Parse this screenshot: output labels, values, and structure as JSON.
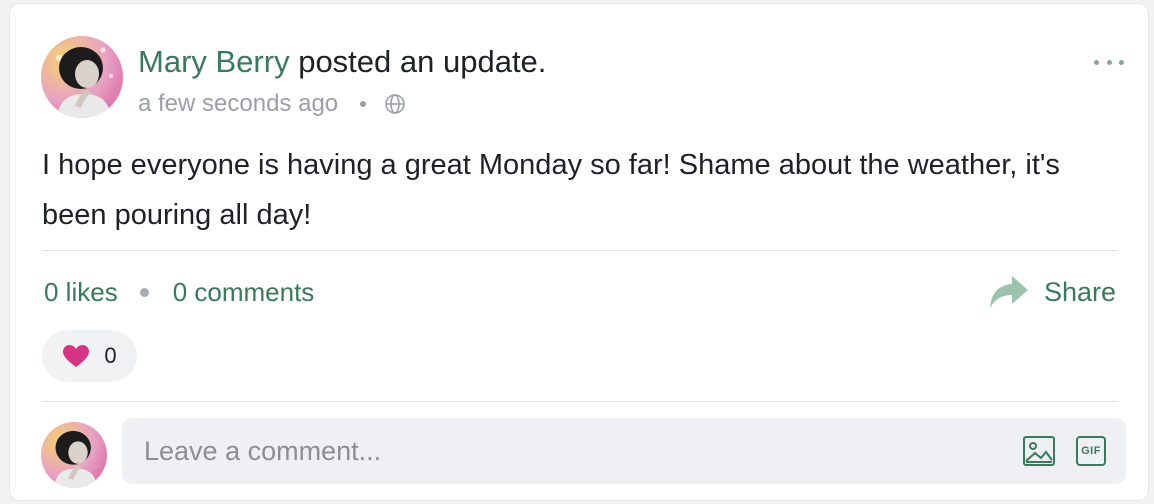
{
  "post": {
    "author": "Mary Berry",
    "action": "posted an update.",
    "timestamp": "a few seconds ago",
    "visibility_icon": "globe-icon",
    "more_icon": "more-options-icon",
    "body": "I hope everyone is having a great Monday so far! Shame about the weather, it's been pouring all day!"
  },
  "stats": {
    "likes": "0 likes",
    "comments": "0 comments"
  },
  "share": {
    "label": "Share",
    "icon": "share-arrow-icon"
  },
  "reaction": {
    "icon": "heart-icon",
    "count": "0",
    "color": "#d63384"
  },
  "comment": {
    "placeholder": "Leave a comment...",
    "image_icon": "image-icon",
    "gif_label": "GIF"
  },
  "colors": {
    "accent": "#3a7a5c",
    "muted": "#9aa0a6",
    "input_bg": "#eef0f3"
  }
}
